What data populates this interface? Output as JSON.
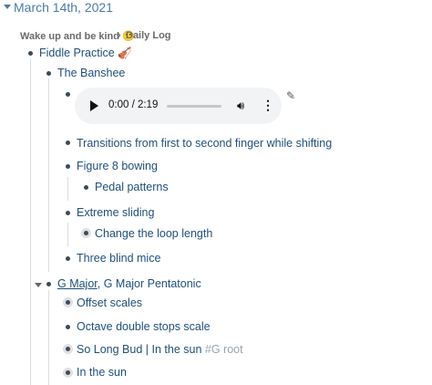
{
  "page": {
    "title": "March 14th, 2021"
  },
  "breadcrumb": {
    "item1": "Wake up and be kind 🙂",
    "sep": "›",
    "item2": "Daily Log"
  },
  "blocks": {
    "fiddle": "Fiddle Practice 🎻",
    "banshee": "The Banshee",
    "audio": {
      "time": "0:00 / 2:19"
    },
    "transitions": "Transitions from first to second finger while shifting",
    "figure8": "Figure 8 bowing",
    "pedal": "Pedal patterns",
    "extreme": "Extreme sliding",
    "loop": "Change the loop length",
    "mice": "Three blind mice",
    "gmajor_ref": "G Major",
    "gmajor_rest": ", G Major Pentatonic",
    "offset": "Offset scales",
    "octave": "Octave double stops scale",
    "solong_a": "So Long Bud",
    "solong_sep": " | ",
    "solong_b": "In the sun",
    "solong_tag": " #G root",
    "inthesun": "In the sun"
  },
  "icons": {
    "title_caret": "caret-down-icon",
    "pencil": "pencil-icon",
    "play": "play-icon",
    "volume": "volume-icon",
    "more": "more-vertical-icon"
  }
}
